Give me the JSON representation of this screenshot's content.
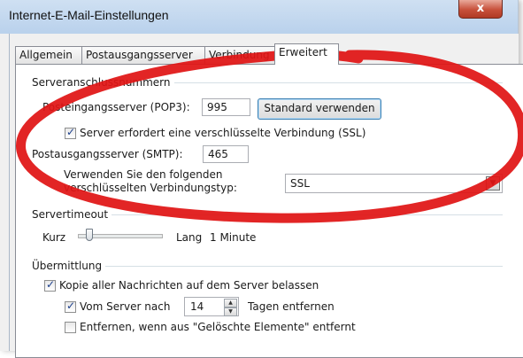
{
  "window": {
    "title": "Internet-E-Mail-Einstellungen",
    "close_glyph": "x"
  },
  "tabs": [
    {
      "label": "Allgemein"
    },
    {
      "label": "Postausgangsserver"
    },
    {
      "label": "Verbindung"
    },
    {
      "label": "Erweitert"
    }
  ],
  "ports": {
    "group_label": "Serveranschlussnummern",
    "incoming_label": "Posteingangsserver (POP3):",
    "incoming_value": "995",
    "default_button": "Standard verwenden",
    "ssl_checkbox_label": "Server erfordert eine verschlüsselte Verbindung (SSL)",
    "ssl_checked": true,
    "outgoing_label": "Postausgangsserver (SMTP):",
    "outgoing_value": "465",
    "encryption_label_line1": "Verwenden Sie den folgenden",
    "encryption_label_line2": "verschlüsselten Verbindungstyp:",
    "encryption_value": "SSL"
  },
  "timeout": {
    "group_label": "Servertimeout",
    "short_label": "Kurz",
    "long_label": "Lang",
    "value_text": "1 Minute",
    "slider_level": 0.1
  },
  "delivery": {
    "group_label": "Übermittlung",
    "keep_copy_label": "Kopie aller Nachrichten auf dem Server belassen",
    "keep_copy_checked": true,
    "remove_after_label": "Vom Server nach",
    "remove_after_checked": true,
    "days_value": "14",
    "days_suffix": "Tagen entfernen",
    "remove_deleted_label": "Entfernen, wenn aus \"Gelöschte Elemente\" entfernt",
    "remove_deleted_checked": false
  },
  "icons": {
    "check": "✓",
    "dropdown": "▼",
    "spin_up": "▲",
    "spin_down": "▼"
  },
  "colors": {
    "annotation": "#e01414"
  }
}
